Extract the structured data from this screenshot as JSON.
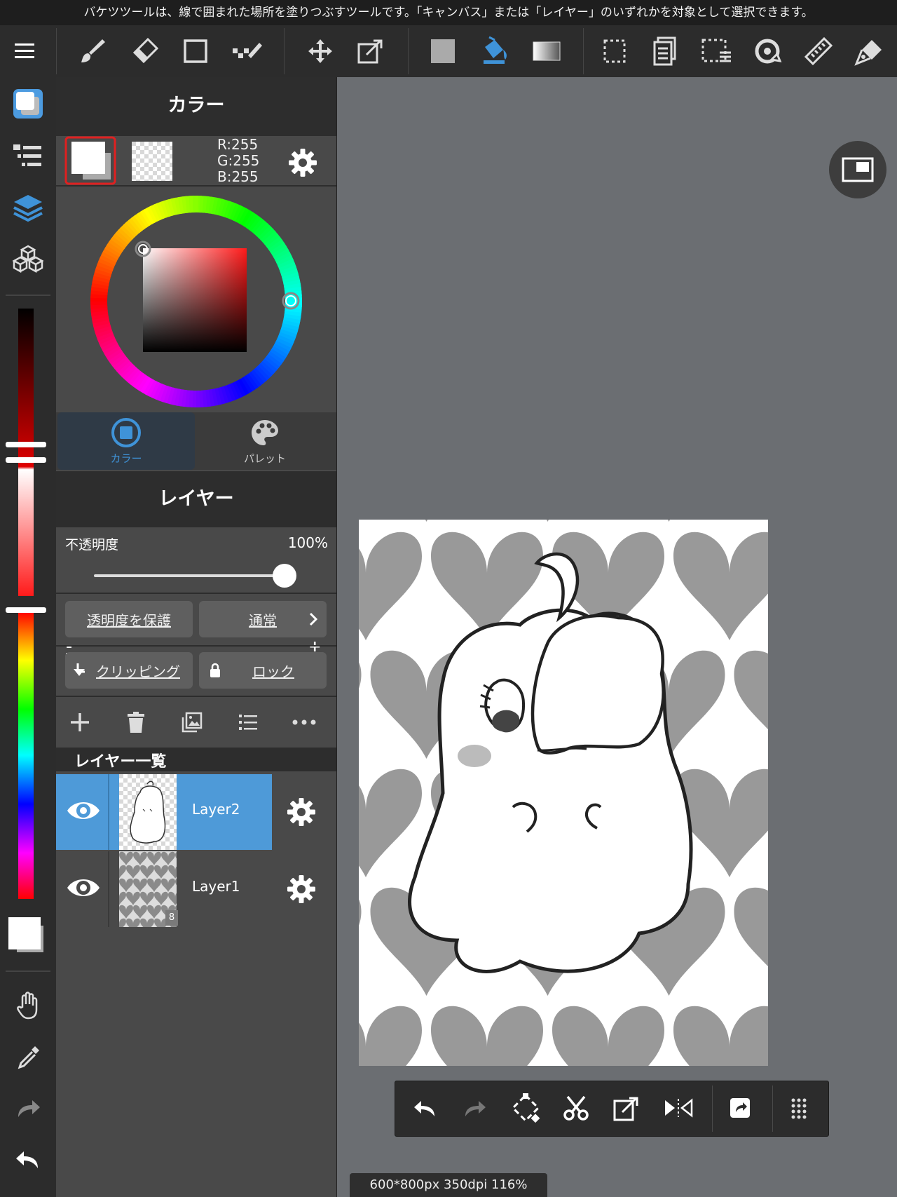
{
  "tip": "バケツツールは、線で囲まれた場所を塗りつぶすツールです。「キャンバス」または「レイヤー」のいずれかを対象として選択できます。",
  "toolbar": {
    "items": [
      "menu-icon",
      "brush-icon",
      "eraser-icon",
      "shape-icon",
      "dot-icon",
      "move-icon",
      "transform-icon",
      "fill-color-icon",
      "bucket-icon",
      "gradient-icon",
      "selection-icon",
      "copy-icon",
      "select-layer-icon",
      "rotate-icon",
      "ruler-icon",
      "pen-icon"
    ],
    "active": "bucket-icon",
    "accent": "#3f93d8"
  },
  "rail": {
    "items": [
      "color-panel-icon",
      "brush-list-icon",
      "layers-icon",
      "materials-icon",
      "hand-icon",
      "eyedropper-icon",
      "redo-icon",
      "undo-icon"
    ],
    "active": "layers-icon",
    "hue_slider_positions": {
      "brightness": 0.93,
      "saturation": 0.07
    }
  },
  "color_panel": {
    "title": "カラー",
    "rgb": {
      "r": "R:255",
      "g": "G:255",
      "b": "B:255"
    },
    "foreground": "#ffffff",
    "tabs": [
      {
        "label": "カラー",
        "icon": "color-circle-icon",
        "active": true
      },
      {
        "label": "パレット",
        "icon": "palette-icon",
        "active": false
      }
    ]
  },
  "layer_panel": {
    "title": "レイヤー",
    "opacity_label": "不透明度",
    "opacity_value": "100%",
    "opacity_fraction": 1.0,
    "minus": "-",
    "plus": "+",
    "protect_alpha": "透明度を保護",
    "blend_mode": "通常",
    "clipping": "クリッピング",
    "lock": "ロック",
    "list_title": "レイヤー一覧",
    "layers": [
      {
        "name": "Layer2",
        "selected": true
      },
      {
        "name": "Layer1",
        "selected": false,
        "badge": "8"
      }
    ]
  },
  "status": "600*800px 350dpi 116%",
  "bottom_bar": [
    "undo-icon",
    "redo-icon",
    "transform-icon",
    "cut-icon",
    "export-icon",
    "flip-icon",
    "share-icon",
    "grid-icon"
  ]
}
